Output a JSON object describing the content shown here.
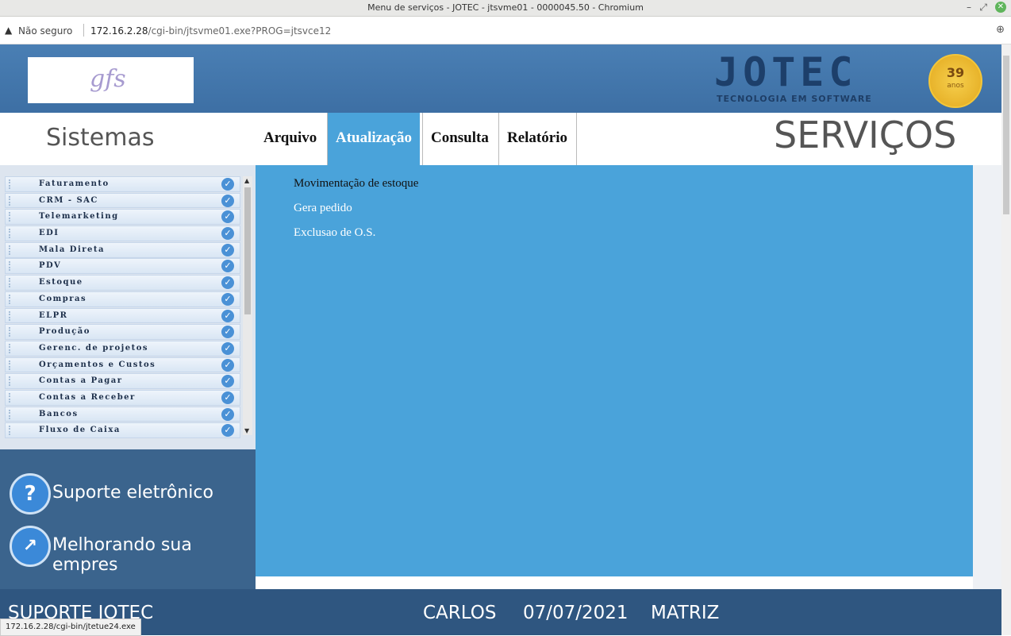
{
  "window": {
    "title": "Menu de serviços - JOTEC - jtsvme01 - 0000045.50 - Chromium"
  },
  "browser": {
    "security": "Não seguro",
    "url_host": "172.16.2.28",
    "url_path": "/cgi-bin/jtsvme01.exe?PROG=jtsvce12"
  },
  "banner": {
    "brand": "JOTEC",
    "tagline": "TECNOLOGIA EM SOFTWARE",
    "badge_number": "39",
    "badge_text": "anos",
    "logo_text": "gfs"
  },
  "header": {
    "sistemas": "Sistemas",
    "servicos": "SERVIÇOS"
  },
  "menu": [
    {
      "label": "Arquivo"
    },
    {
      "label": "Atualização"
    },
    {
      "label": "Consulta"
    },
    {
      "label": "Relatório"
    }
  ],
  "systems": [
    "Faturamento",
    "CRM - SAC",
    "Telemarketing",
    "EDI",
    "Mala Direta",
    "PDV",
    "Estoque",
    "Compras",
    "ELPR",
    "Produção",
    "Gerenc. de projetos",
    "Orçamentos e Custos",
    "Contas a Pagar",
    "Contas a Receber",
    "Bancos",
    "Fluxo de Caixa"
  ],
  "support": {
    "item1": "Suporte eletrônico",
    "item2": "Melhorando sua empres"
  },
  "dropdown": {
    "item1": "Movimentação de estoque",
    "item2": "Gera pedido",
    "item3": "Exclusao de O.S."
  },
  "footer": {
    "left": "SUPORTE JOTEC",
    "user": "CARLOS",
    "date": "07/07/2021",
    "branch": "MATRIZ"
  },
  "status": {
    "url": "172.16.2.28/cgi-bin/jtetue24.exe"
  }
}
